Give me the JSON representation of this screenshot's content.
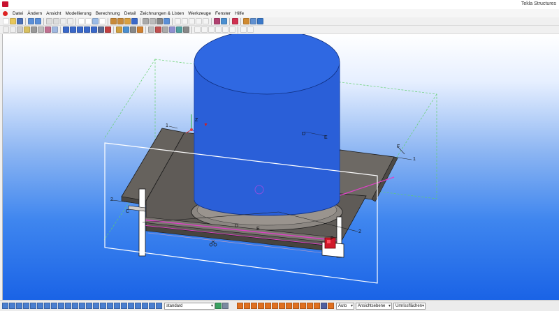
{
  "window": {
    "title": "Tekla Structures"
  },
  "menu": {
    "items": [
      {
        "label": "Datei"
      },
      {
        "label": "Ändern"
      },
      {
        "label": "Ansicht"
      },
      {
        "label": "Modellierung"
      },
      {
        "label": "Berechnung"
      },
      {
        "label": "Detail"
      },
      {
        "label": "Zeichnungen & Listen"
      },
      {
        "label": "Werkzeuge"
      },
      {
        "label": "Fenster"
      },
      {
        "label": "Hilfe"
      }
    ]
  },
  "viewport": {
    "labels": {
      "l1_left": "1",
      "l1_right": "1",
      "l2_left": "2",
      "l2_right": "2",
      "c_left": "C",
      "d_top": "D",
      "e_top": "E",
      "d_bottom": "D",
      "e_bottom": "E",
      "f_right": "F",
      "f_bottom": "F",
      "axis_z": "Z"
    }
  },
  "statusbar": {
    "filter_value": "standard",
    "snap_mode": "Auto",
    "plane_mode": "Ansichtsebene",
    "select_mode": "Umrissflächen"
  },
  "colors": {
    "tank_fill": "#2a5fd8",
    "tank_top": "#2f68e2",
    "steel": "#6b6762",
    "highlight": "#e040c8",
    "selected_part": "#d11a2a"
  }
}
